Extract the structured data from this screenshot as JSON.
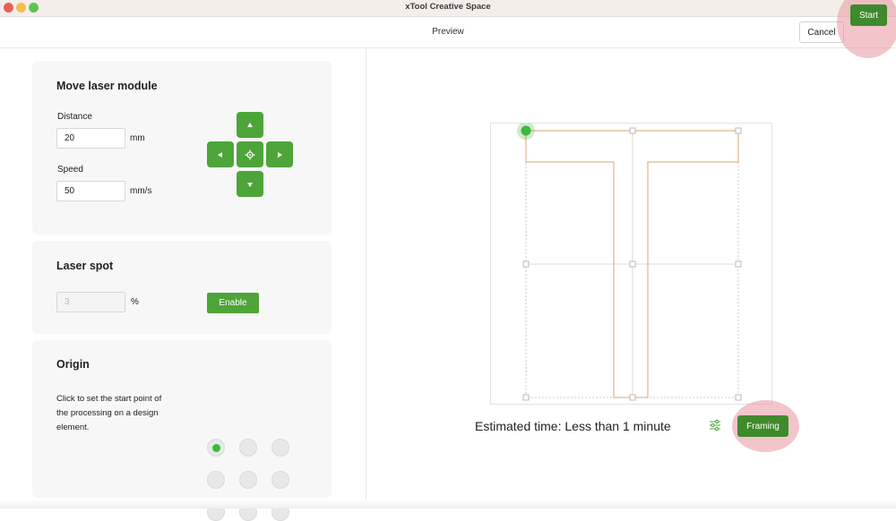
{
  "window": {
    "title": "xTool Creative Space"
  },
  "header": {
    "title": "Preview",
    "cancel_label": "Cancel",
    "start_label": "Start"
  },
  "move_laser": {
    "title": "Move laser module",
    "distance_label": "Distance",
    "distance_value": "20",
    "distance_unit": "mm",
    "speed_label": "Speed",
    "speed_value": "50",
    "speed_unit": "mm/s",
    "directions": [
      "up-arrow-icon",
      "left-arrow-icon",
      "home-crosshair-icon",
      "right-arrow-icon",
      "down-arrow-icon"
    ]
  },
  "laser_spot": {
    "title": "Laser spot",
    "value": "3",
    "unit": "%",
    "enable_label": "Enable"
  },
  "origin": {
    "title": "Origin",
    "description": "Click to set the start point of the processing on a design element.",
    "selected_index": 0,
    "positions": 9
  },
  "preview": {
    "estimated_time": "Estimated time: Less than 1 minute",
    "framing_label": "Framing",
    "settings_icon": "sliders-icon"
  },
  "colors": {
    "accent": "#4da53a",
    "accent_dark": "#3f8a2c",
    "highlight": "#e896a0",
    "design_stroke": "#e2b48d"
  }
}
